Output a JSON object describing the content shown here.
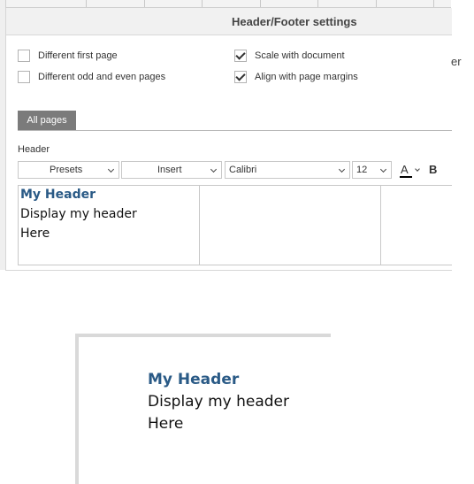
{
  "dialog": {
    "title": "Header/Footer settings",
    "right_stub": "er"
  },
  "options": {
    "different_first_page": {
      "label": "Different first page",
      "checked": false
    },
    "different_odd_even": {
      "label": "Different odd and even pages",
      "checked": false
    },
    "scale_with_document": {
      "label": "Scale with document",
      "checked": true
    },
    "align_with_margins": {
      "label": "Align with page margins",
      "checked": true
    }
  },
  "tabs": [
    {
      "label": "All pages",
      "active": true
    }
  ],
  "header_section": {
    "label": "Header"
  },
  "toolbar": {
    "presets_label": "Presets",
    "insert_label": "Insert",
    "font_name": "Calibri",
    "font_size": "12",
    "font_color_glyph": "A",
    "bold_glyph": "B"
  },
  "editor": {
    "left_lines": [
      "My Header",
      "Display my header",
      "Here"
    ],
    "center_lines": [],
    "right_lines": []
  },
  "preview": {
    "lines": [
      "My Header",
      "Display my header",
      "Here"
    ]
  },
  "colors": {
    "header_title": "#2a5a86",
    "tab_active_bg": "#7b7b7b"
  }
}
